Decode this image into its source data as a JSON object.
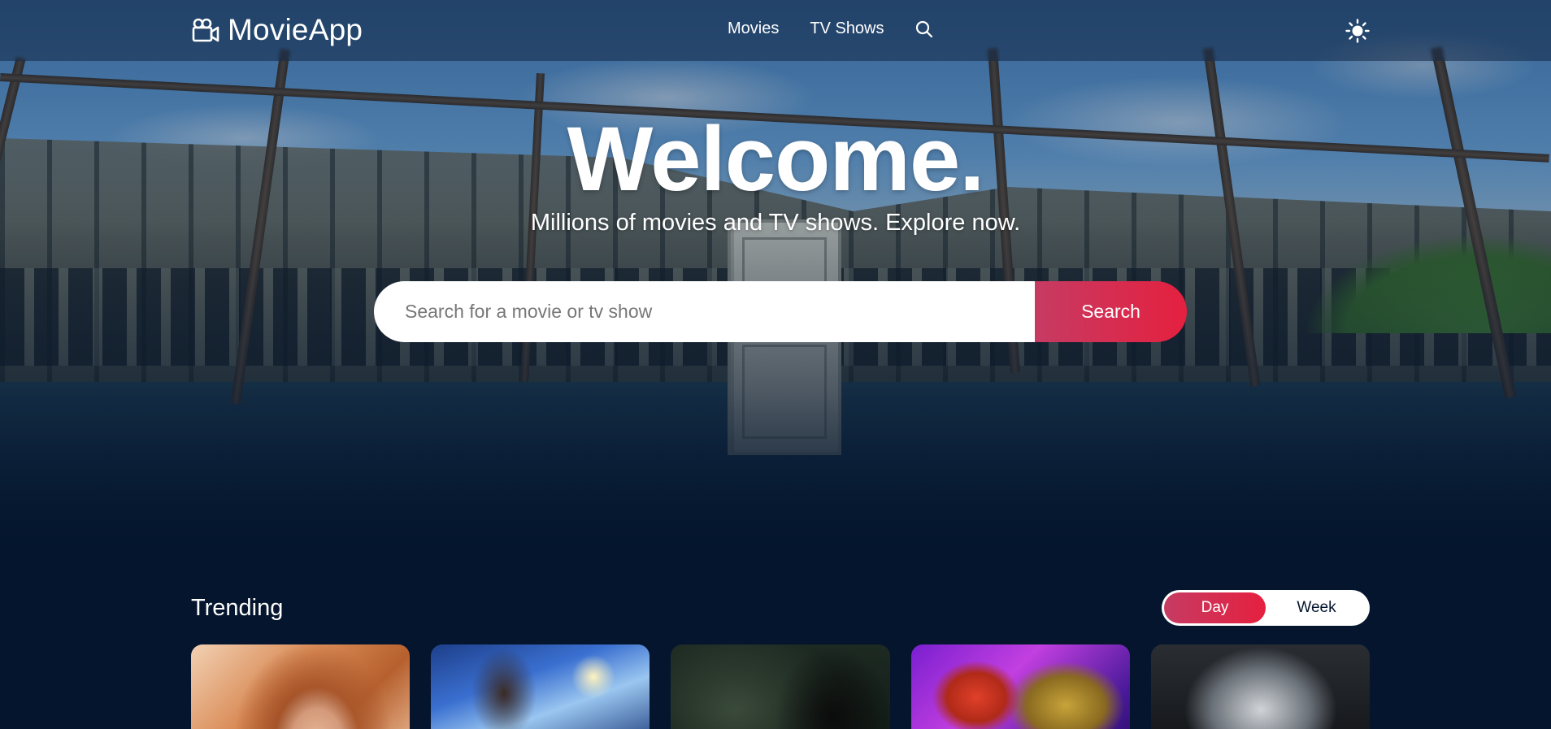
{
  "app": {
    "name": "MovieApp"
  },
  "nav": {
    "items": [
      {
        "label": "Movies"
      },
      {
        "label": "TV Shows"
      }
    ],
    "search_icon": "search-icon",
    "theme_icon": "sun-icon"
  },
  "hero": {
    "title": "Welcome.",
    "subtitle": "Millions of movies and TV shows. Explore now.",
    "search": {
      "placeholder": "Search for a movie or tv show",
      "value": "",
      "button_label": "Search"
    }
  },
  "trending": {
    "title": "Trending",
    "switch": {
      "options": [
        "Day",
        "Week"
      ],
      "selected": "Day"
    },
    "cards": [
      {
        "id": 1
      },
      {
        "id": 2
      },
      {
        "id": 3
      },
      {
        "id": 4
      },
      {
        "id": 5
      }
    ]
  },
  "colors": {
    "background": "#04152d",
    "accent_start": "#c63b63",
    "accent_end": "#e5203f",
    "text": "#ffffff"
  }
}
